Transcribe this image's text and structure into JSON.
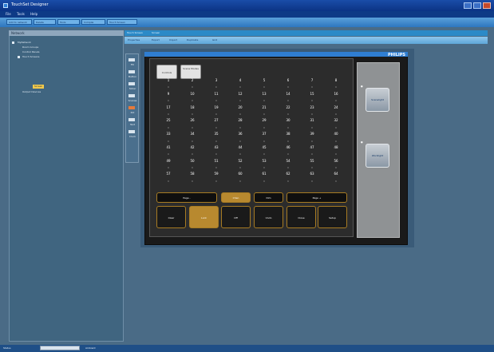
{
  "window": {
    "title": "TouchSet Designer"
  },
  "menu": [
    "File",
    "Tools",
    "Help"
  ],
  "toolbar": [
    "Add to network",
    "Delete",
    "Tools",
    "Compile",
    "Touch Screen"
  ],
  "sidebar": {
    "header": "Network",
    "tree": [
      {
        "label": "MyNetwork",
        "level": 0
      },
      {
        "label": "Room Groups",
        "level": 1
      },
      {
        "label": "Control Panels",
        "level": 1
      },
      {
        "label": "Touch Screens",
        "level": 1
      },
      {
        "label": "Screen",
        "level": 2,
        "selected": true
      },
      {
        "label": "Output Devices",
        "level": 1
      }
    ]
  },
  "main": {
    "tabs": [
      "Touch Screen",
      "Screen"
    ],
    "tools": [
      "Properties",
      "Export",
      "Import",
      "Duplicate",
      "Grid"
    ],
    "palette": [
      "Fill",
      "Button",
      "Slider",
      "Scenes",
      "Pot",
      "Text",
      "Clock"
    ]
  },
  "device": {
    "brand": "PHILIPS",
    "top_buttons": [
      "Controls",
      "Scene Modes"
    ],
    "grid": [
      [
        "1",
        "2",
        "3",
        "4",
        "5",
        "6",
        "7",
        "8"
      ],
      [
        "9",
        "10",
        "11",
        "12",
        "13",
        "14",
        "15",
        "16"
      ],
      [
        "17",
        "18",
        "19",
        "20",
        "21",
        "22",
        "23",
        "24"
      ],
      [
        "25",
        "26",
        "27",
        "28",
        "29",
        "30",
        "31",
        "32"
      ],
      [
        "33",
        "34",
        "35",
        "36",
        "37",
        "38",
        "39",
        "40"
      ],
      [
        "41",
        "42",
        "43",
        "44",
        "45",
        "46",
        "47",
        "48"
      ],
      [
        "49",
        "50",
        "51",
        "52",
        "53",
        "54",
        "55",
        "56"
      ],
      [
        "57",
        "58",
        "59",
        "60",
        "61",
        "62",
        "63",
        "64"
      ]
    ],
    "page_bar": [
      "Page -",
      "Chan",
      "Dim",
      "Page +"
    ],
    "bottom_buttons": [
      "Clear",
      "Lock",
      "Off",
      "Undo",
      "Close",
      "Setup"
    ],
    "right_buttons": [
      "Scenelight",
      "Worklight"
    ]
  },
  "status": {
    "label": "Status",
    "field": "",
    "user": "Ambient"
  },
  "colors": {
    "title": "#1a4da8",
    "accent": "#b8892f",
    "panel": "#406580"
  }
}
